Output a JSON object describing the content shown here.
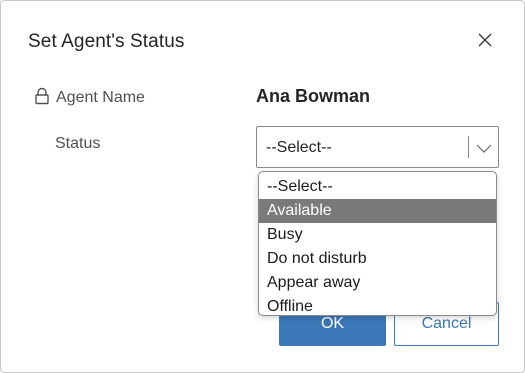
{
  "dialog": {
    "title": "Set Agent's Status",
    "close_icon": "close-icon"
  },
  "form": {
    "agent_label": "Agent Name",
    "agent_lock_icon": "lock-icon",
    "agent_name": "Ana Bowman",
    "status_label": "Status",
    "status_selected": "--Select--",
    "status_chevron_icon": "chevron-down-icon"
  },
  "dropdown": {
    "options": [
      "--Select--",
      "Available",
      "Busy",
      "Do not disturb",
      "Appear away",
      "Offline"
    ],
    "highlighted": "Available"
  },
  "buttons": {
    "ok_label": "OK",
    "cancel_label": "Cancel"
  },
  "colors": {
    "accent": "#3a78b7",
    "highlight": "#7a7a7a"
  }
}
